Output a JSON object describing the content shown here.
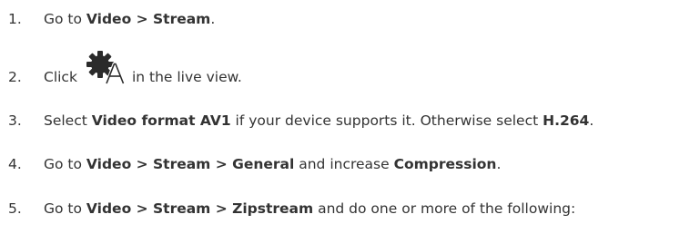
{
  "steps": [
    {
      "number": "1.",
      "parts": [
        {
          "text": "Go to ",
          "bold": false
        },
        {
          "text": "Video > Stream",
          "bold": true
        },
        {
          "text": ".",
          "bold": false
        }
      ]
    },
    {
      "number": "2.",
      "parts": [
        {
          "text": "Click",
          "bold": false
        },
        {
          "icon": "auto-settings-gear-icon"
        },
        {
          "text": "in the live view.",
          "bold": false
        }
      ]
    },
    {
      "number": "3.",
      "parts": [
        {
          "text": "Select ",
          "bold": false
        },
        {
          "text": "Video format AV1",
          "bold": true
        },
        {
          "text": " if your device supports it. Otherwise select ",
          "bold": false
        },
        {
          "text": "H.264",
          "bold": true
        },
        {
          "text": ".",
          "bold": false
        }
      ]
    },
    {
      "number": "4.",
      "parts": [
        {
          "text": "Go to ",
          "bold": false
        },
        {
          "text": "Video > Stream > General",
          "bold": true
        },
        {
          "text": " and increase ",
          "bold": false
        },
        {
          "text": "Compression",
          "bold": true
        },
        {
          "text": ".",
          "bold": false
        }
      ]
    },
    {
      "number": "5.",
      "parts": [
        {
          "text": "Go to ",
          "bold": false
        },
        {
          "text": "Video > Stream > Zipstream",
          "bold": true
        },
        {
          "text": " and do one or more of the following:",
          "bold": false
        }
      ]
    }
  ]
}
